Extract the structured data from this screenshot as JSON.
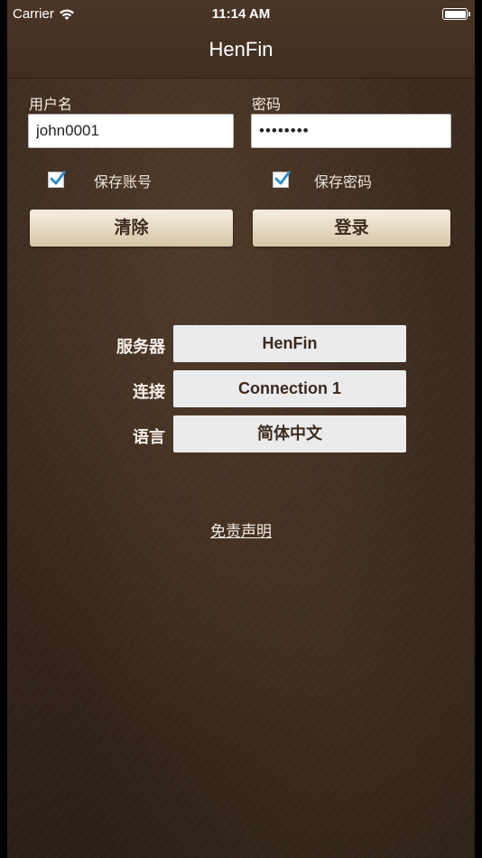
{
  "status_bar": {
    "carrier": "Carrier",
    "time": "11:14 AM",
    "icons": [
      "wifi-icon",
      "battery-icon"
    ]
  },
  "nav": {
    "title": "HenFin"
  },
  "login": {
    "username_label": "用户名",
    "username_value": "john0001",
    "password_label": "密码",
    "password_value": "••••••••",
    "save_account_label": "保存账号",
    "save_account_checked": true,
    "save_password_label": "保存密码",
    "save_password_checked": true,
    "clear_button": "清除",
    "login_button": "登录"
  },
  "settings": {
    "server_label": "服务器",
    "server_value": "HenFin",
    "connection_label": "连接",
    "connection_value": "Connection 1",
    "language_label": "语言",
    "language_value": "简体中文"
  },
  "footer": {
    "disclaimer_link": "免责声明"
  },
  "colors": {
    "background": "#3a2a1f",
    "header": "#412e21",
    "button_gold": "#e8dcc6",
    "checkbox_accent": "#2f8fcf"
  }
}
